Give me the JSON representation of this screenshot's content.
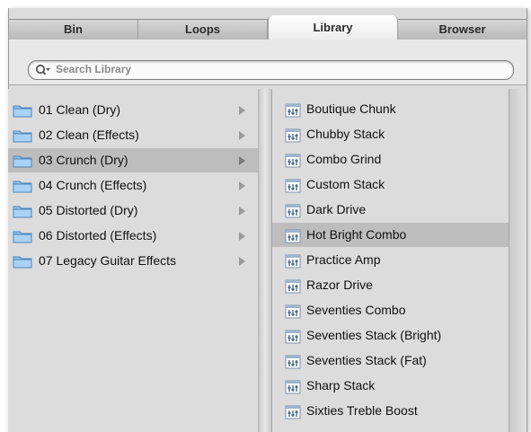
{
  "tabs": [
    {
      "label": "Bin",
      "active": false
    },
    {
      "label": "Loops",
      "active": false
    },
    {
      "label": "Library",
      "active": true
    },
    {
      "label": "Browser",
      "active": false
    }
  ],
  "search": {
    "placeholder": "Search Library",
    "icon": "magnifier-with-dropdown-icon"
  },
  "folders": [
    {
      "label": "01 Clean (Dry)",
      "selected": false
    },
    {
      "label": "02 Clean (Effects)",
      "selected": false
    },
    {
      "label": "03 Crunch (Dry)",
      "selected": true
    },
    {
      "label": "04 Crunch (Effects)",
      "selected": false
    },
    {
      "label": "05 Distorted (Dry)",
      "selected": false
    },
    {
      "label": "06 Distorted (Effects)",
      "selected": false
    },
    {
      "label": "07 Legacy Guitar Effects",
      "selected": false
    }
  ],
  "patches": [
    {
      "label": "Boutique Chunk",
      "selected": false
    },
    {
      "label": "Chubby Stack",
      "selected": false
    },
    {
      "label": "Combo Grind",
      "selected": false
    },
    {
      "label": "Custom Stack",
      "selected": false
    },
    {
      "label": "Dark Drive",
      "selected": false
    },
    {
      "label": "Hot Bright Combo",
      "selected": true
    },
    {
      "label": "Practice Amp",
      "selected": false
    },
    {
      "label": "Razor Drive",
      "selected": false
    },
    {
      "label": "Seventies Combo",
      "selected": false
    },
    {
      "label": "Seventies Stack (Bright)",
      "selected": false
    },
    {
      "label": "Seventies Stack (Fat)",
      "selected": false
    },
    {
      "label": "Sharp Stack",
      "selected": false
    },
    {
      "label": "Sixties Treble Boost",
      "selected": false
    }
  ],
  "colors": {
    "selection": "#bdbdbd",
    "folder": "#7fb6e6",
    "background": "#dcdcdc"
  }
}
